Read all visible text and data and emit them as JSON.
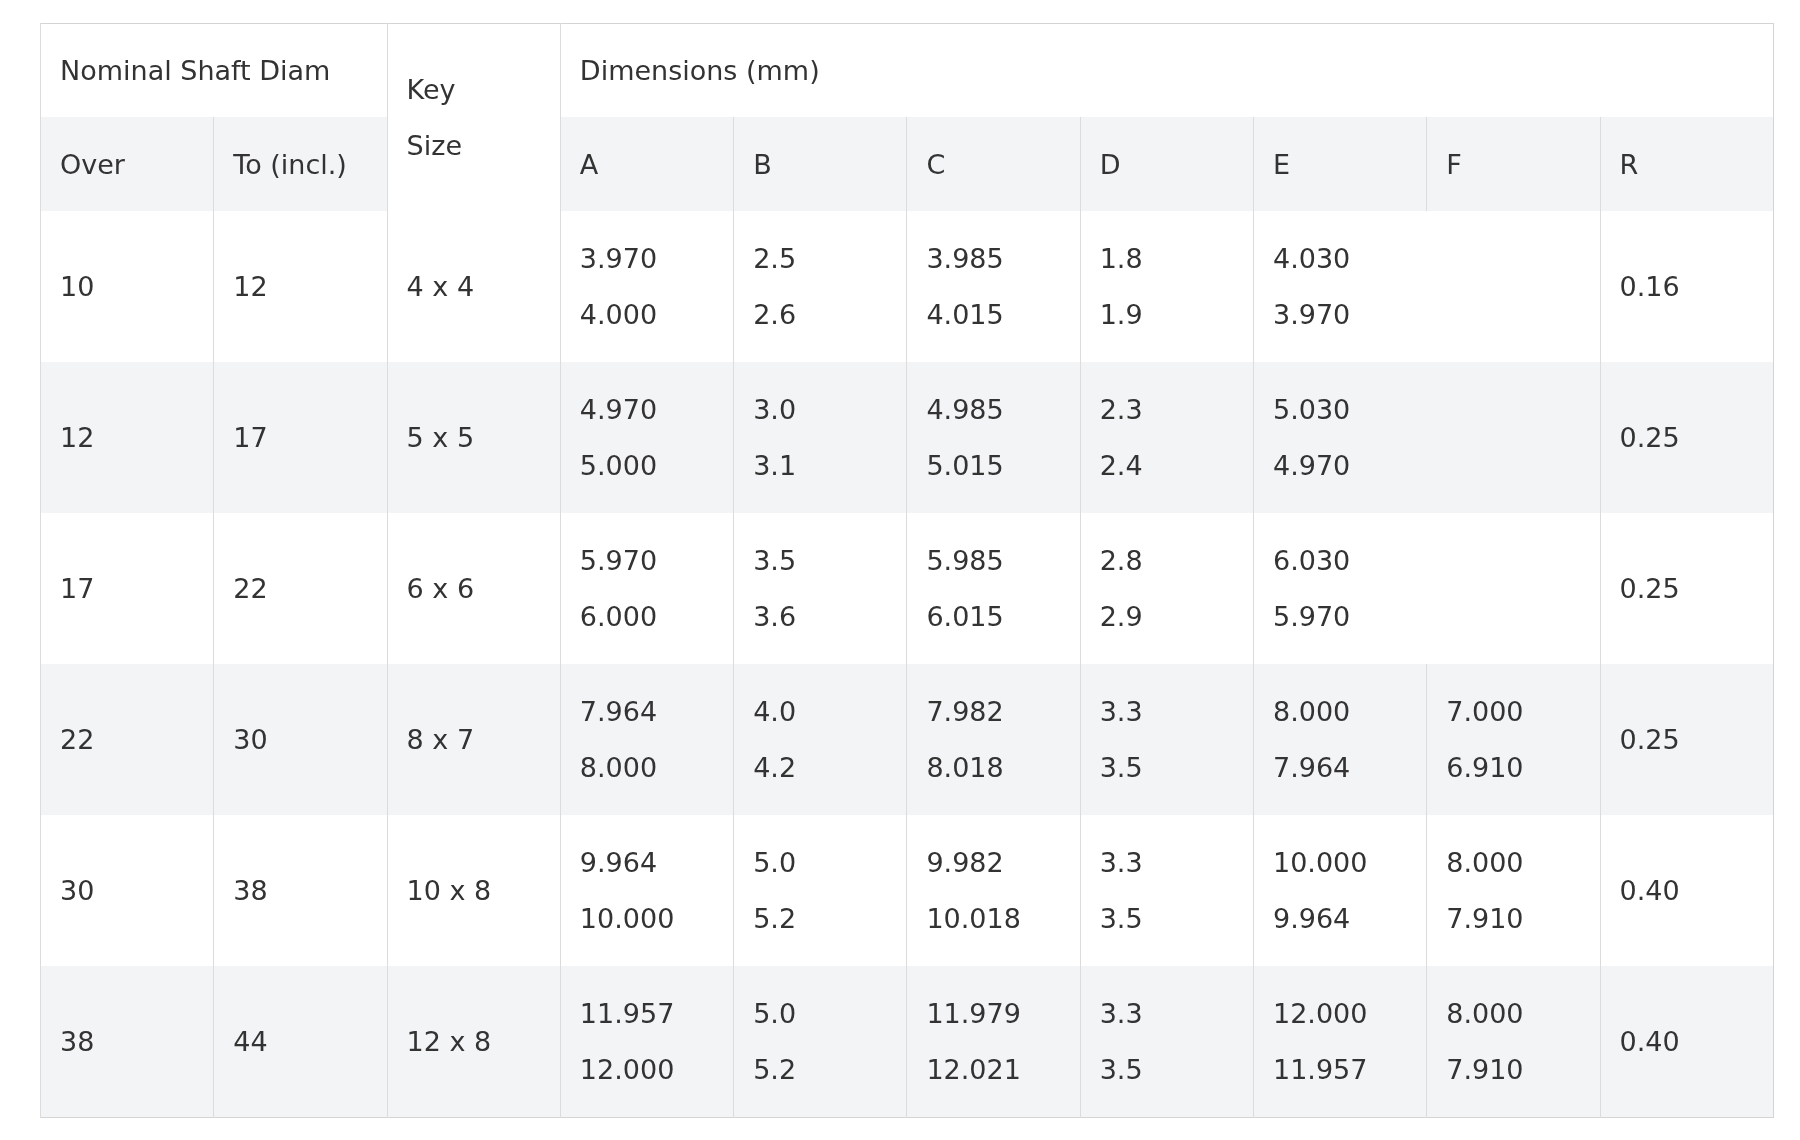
{
  "table": {
    "group_headers": {
      "shaft": "Nominal Shaft Diam",
      "key": "Key Size",
      "dims": "Dimensions (mm)"
    },
    "sub_headers": {
      "over": "Over",
      "to": "To (incl.)"
    },
    "dim_columns": [
      "A",
      "B",
      "C",
      "D",
      "E",
      "F",
      "R"
    ],
    "rows": [
      {
        "over": "10",
        "to": "12",
        "key": "4 x 4",
        "A": [
          "3.970",
          "4.000"
        ],
        "B": [
          "2.5",
          "2.6"
        ],
        "C": [
          "3.985",
          "4.015"
        ],
        "D": [
          "1.8",
          "1.9"
        ],
        "E": [
          "4.030",
          "3.970"
        ],
        "F": null,
        "R": "0.16"
      },
      {
        "over": "12",
        "to": "17",
        "key": "5 x 5",
        "A": [
          "4.970",
          "5.000"
        ],
        "B": [
          "3.0",
          "3.1"
        ],
        "C": [
          "4.985",
          "5.015"
        ],
        "D": [
          "2.3",
          "2.4"
        ],
        "E": [
          "5.030",
          "4.970"
        ],
        "F": null,
        "R": "0.25"
      },
      {
        "over": "17",
        "to": "22",
        "key": "6 x 6",
        "A": [
          "5.970",
          "6.000"
        ],
        "B": [
          "3.5",
          "3.6"
        ],
        "C": [
          "5.985",
          "6.015"
        ],
        "D": [
          "2.8",
          "2.9"
        ],
        "E": [
          "6.030",
          "5.970"
        ],
        "F": null,
        "R": "0.25"
      },
      {
        "over": "22",
        "to": "30",
        "key": "8 x 7",
        "A": [
          "7.964",
          "8.000"
        ],
        "B": [
          "4.0",
          "4.2"
        ],
        "C": [
          "7.982",
          "8.018"
        ],
        "D": [
          "3.3",
          "3.5"
        ],
        "E": [
          "8.000",
          "7.964"
        ],
        "F": [
          "7.000",
          "6.910"
        ],
        "R": "0.25"
      },
      {
        "over": "30",
        "to": "38",
        "key": "10 x 8",
        "A": [
          "9.964",
          "10.000"
        ],
        "B": [
          "5.0",
          "5.2"
        ],
        "C": [
          "9.982",
          "10.018"
        ],
        "D": [
          "3.3",
          "3.5"
        ],
        "E": [
          "10.000",
          "9.964"
        ],
        "F": [
          "8.000",
          "7.910"
        ],
        "R": "0.40"
      },
      {
        "over": "38",
        "to": "44",
        "key": "12 x 8",
        "A": [
          "11.957",
          "12.000"
        ],
        "B": [
          "5.0",
          "5.2"
        ],
        "C": [
          "11.979",
          "12.021"
        ],
        "D": [
          "3.3",
          "3.5"
        ],
        "E": [
          "12.000",
          "11.957"
        ],
        "F": [
          "8.000",
          "7.910"
        ],
        "R": "0.40"
      }
    ]
  }
}
